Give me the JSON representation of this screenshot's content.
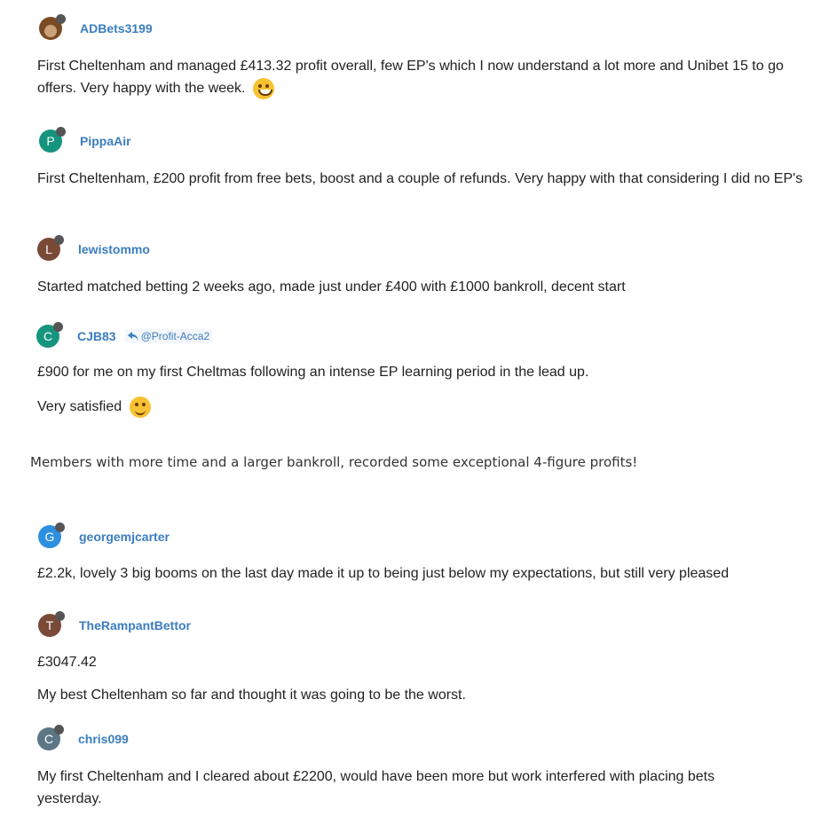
{
  "colors": {
    "username": "#3b7dbf",
    "text": "#222222"
  },
  "posts": [
    {
      "username": "ADBets3199",
      "avatar_letter": "",
      "avatar_color": "#7a4a22",
      "text": "First Cheltenham and managed £413.32 profit overall, few EP's which I now understand a lot more and Unibet 15 to go offers. Very happy with the week.",
      "emoji": "grinning-face-icon"
    },
    {
      "username": "PippaAir",
      "avatar_letter": "P",
      "avatar_color": "#16957e",
      "text": "First Cheltenham, £200 profit from free bets, boost and a couple of refunds. Very happy with that considering I did no EP's"
    },
    {
      "username": "lewistommo",
      "avatar_letter": "L",
      "avatar_color": "#7a4a38",
      "text": "Started matched betting 2 weeks ago, made just under £400 with £1000 bankroll, decent start"
    },
    {
      "username": "CJB83",
      "avatar_letter": "C",
      "avatar_color": "#16957e",
      "reply_to": "@Profit-Acca2",
      "text": "£900 for me on my first Cheltmas following an intense EP learning period in the lead up.",
      "text2": "Very satisfied",
      "emoji": "smiling-face-icon"
    },
    {
      "username": "georgemjcarter",
      "avatar_letter": "G",
      "avatar_color": "#2d8fe0",
      "text": "£2.2k, lovely 3 big booms on the last day made it up to being just below my expectations, but still very pleased"
    },
    {
      "username": "TheRampantBettor",
      "avatar_letter": "T",
      "avatar_color": "#7a4a38",
      "text": "£3047.42",
      "text2": "My best Cheltenham so far and thought it was going to be the worst."
    },
    {
      "username": "chris099",
      "avatar_letter": "C",
      "avatar_color": "#5d7686",
      "text": "My first Cheltenham and I cleared about £2200, would have been more but work interfered with placing bets yesterday."
    }
  ],
  "banner": "Members with more time and a larger bankroll, recorded some exceptional 4-figure profits!"
}
